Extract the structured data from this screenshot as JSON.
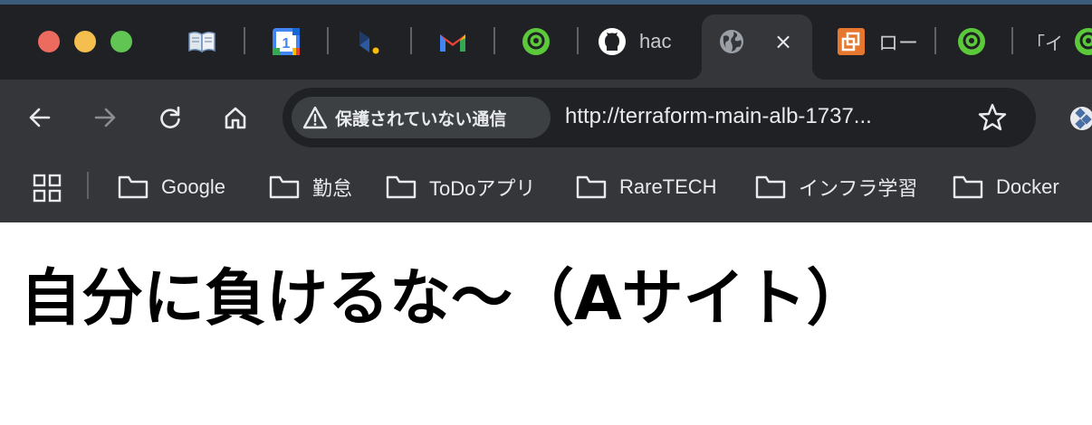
{
  "window": {
    "traffic_lights": [
      "close",
      "minimize",
      "maximize"
    ]
  },
  "tabs": [
    {
      "icon": "book-icon",
      "title": ""
    },
    {
      "icon": "google-calendar-icon",
      "title": "",
      "calendar_day": "1"
    },
    {
      "icon": "dark-app-icon",
      "title": ""
    },
    {
      "icon": "gmail-icon",
      "title": ""
    },
    {
      "icon": "green-app-icon",
      "title": ""
    },
    {
      "icon": "github-icon",
      "title": "hac"
    },
    {
      "icon": "globe-icon",
      "title": "",
      "active": true,
      "close_label": "×"
    },
    {
      "icon": "orange-app-icon",
      "title": "ロー"
    },
    {
      "icon": "green-app-icon",
      "title": ""
    },
    {
      "icon": "page-icon",
      "title": "「イ"
    },
    {
      "icon": "green-app-icon",
      "title": ""
    }
  ],
  "toolbar": {
    "back": "back-icon",
    "forward": "forward-icon",
    "reload": "reload-icon",
    "home": "home-icon",
    "security_chip": "保護されていない通信",
    "url": "http://terraform-main-alb-1737...",
    "bookmark_star": "star-icon"
  },
  "bookmarks": [
    {
      "label": "Google"
    },
    {
      "label": "勤怠"
    },
    {
      "label": "ToDoアプリ"
    },
    {
      "label": "RareTECH"
    },
    {
      "label": "インフラ学習"
    },
    {
      "label": "Docker"
    }
  ],
  "page": {
    "heading": "自分に負けるな〜（Aサイト）"
  },
  "colors": {
    "tabstrip": "#202124",
    "toolbar": "#35363a",
    "omnibox": "#202124",
    "text": "#e8eaed"
  }
}
